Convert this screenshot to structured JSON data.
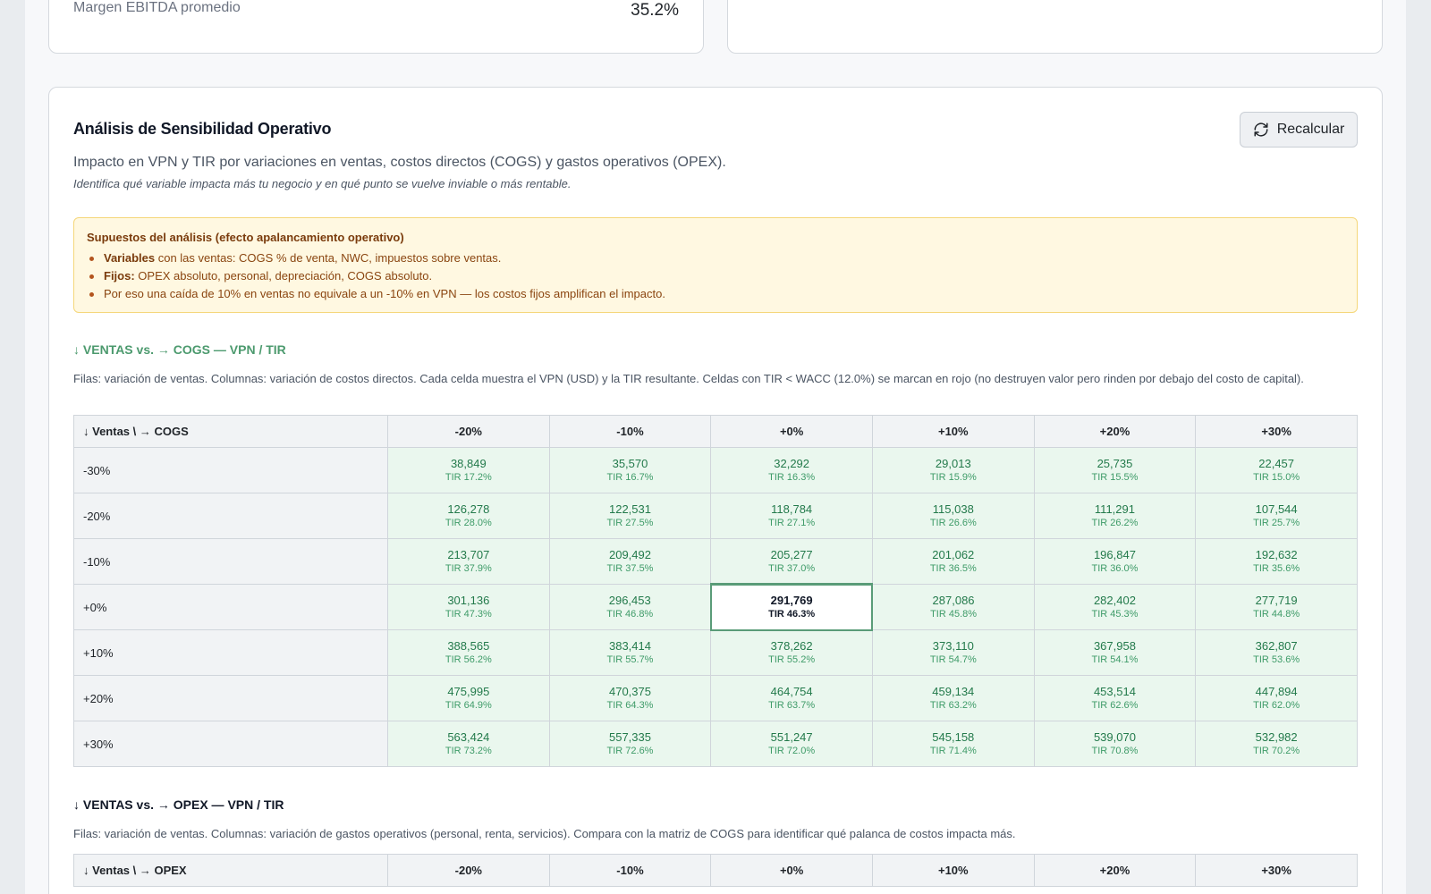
{
  "top_cards": {
    "left": {
      "label": "Margen EBITDA promedio",
      "value": "35.2%"
    }
  },
  "sensitivity": {
    "title": "Análisis de Sensibilidad Operativo",
    "recalc_label": "Recalcular",
    "subtitle": "Impacto en VPN y TIR por variaciones en ventas, costos directos (COGS) y gastos operativos (OPEX).",
    "subtitle_italic": "Identifica qué variable impacta más tu negocio y en qué punto se vuelve inviable o más rentable.",
    "assumptions": {
      "title": "Supuestos del análisis (efecto apalancamiento operativo)",
      "items": [
        {
          "strong": "Variables",
          "text": " con las ventas: COGS % de venta, NWC, impuestos sobre ventas."
        },
        {
          "strong": "Fijos:",
          "text": " OPEX absoluto, personal, depreciación, COGS absoluto."
        },
        {
          "strong": "",
          "text": "Por eso una caída de 10% en ventas no equivale a un -10% en VPN — los costos fijos amplifican el impacto."
        }
      ]
    },
    "matrix_cogs": {
      "title": "↓ VENTAS vs. → COGS — VPN / TIR",
      "description": "Filas: variación de ventas. Columnas: variación de costos directos. Cada celda muestra el VPN (USD) y la TIR resultante. Celdas con TIR < WACC (12.0%) se marcan en rojo (no destruyen valor pero rinden por debajo del costo de capital).",
      "corner": "↓ Ventas \\ → COGS",
      "columns": [
        "-20%",
        "-10%",
        "+0%",
        "+10%",
        "+20%",
        "+30%"
      ],
      "rows": [
        {
          "label": "-30%",
          "cells": [
            [
              "38,849",
              "TIR 17.2%"
            ],
            [
              "35,570",
              "TIR 16.7%"
            ],
            [
              "32,292",
              "TIR 16.3%"
            ],
            [
              "29,013",
              "TIR 15.9%"
            ],
            [
              "25,735",
              "TIR 15.5%"
            ],
            [
              "22,457",
              "TIR 15.0%"
            ]
          ]
        },
        {
          "label": "-20%",
          "cells": [
            [
              "126,278",
              "TIR 28.0%"
            ],
            [
              "122,531",
              "TIR 27.5%"
            ],
            [
              "118,784",
              "TIR 27.1%"
            ],
            [
              "115,038",
              "TIR 26.6%"
            ],
            [
              "111,291",
              "TIR 26.2%"
            ],
            [
              "107,544",
              "TIR 25.7%"
            ]
          ]
        },
        {
          "label": "-10%",
          "cells": [
            [
              "213,707",
              "TIR 37.9%"
            ],
            [
              "209,492",
              "TIR 37.5%"
            ],
            [
              "205,277",
              "TIR 37.0%"
            ],
            [
              "201,062",
              "TIR 36.5%"
            ],
            [
              "196,847",
              "TIR 36.0%"
            ],
            [
              "192,632",
              "TIR 35.6%"
            ]
          ]
        },
        {
          "label": "+0%",
          "cells": [
            [
              "301,136",
              "TIR 47.3%"
            ],
            [
              "296,453",
              "TIR 46.8%"
            ],
            [
              "291,769",
              "TIR 46.3%"
            ],
            [
              "287,086",
              "TIR 45.8%"
            ],
            [
              "282,402",
              "TIR 45.3%"
            ],
            [
              "277,719",
              "TIR 44.8%"
            ]
          ]
        },
        {
          "label": "+10%",
          "cells": [
            [
              "388,565",
              "TIR 56.2%"
            ],
            [
              "383,414",
              "TIR 55.7%"
            ],
            [
              "378,262",
              "TIR 55.2%"
            ],
            [
              "373,110",
              "TIR 54.7%"
            ],
            [
              "367,958",
              "TIR 54.1%"
            ],
            [
              "362,807",
              "TIR 53.6%"
            ]
          ]
        },
        {
          "label": "+20%",
          "cells": [
            [
              "475,995",
              "TIR 64.9%"
            ],
            [
              "470,375",
              "TIR 64.3%"
            ],
            [
              "464,754",
              "TIR 63.7%"
            ],
            [
              "459,134",
              "TIR 63.2%"
            ],
            [
              "453,514",
              "TIR 62.6%"
            ],
            [
              "447,894",
              "TIR 62.0%"
            ]
          ]
        },
        {
          "label": "+30%",
          "cells": [
            [
              "563,424",
              "TIR 73.2%"
            ],
            [
              "557,335",
              "TIR 72.6%"
            ],
            [
              "551,247",
              "TIR 72.0%"
            ],
            [
              "545,158",
              "TIR 71.4%"
            ],
            [
              "539,070",
              "TIR 70.8%"
            ],
            [
              "532,982",
              "TIR 70.2%"
            ]
          ]
        }
      ]
    },
    "matrix_opex": {
      "title": "↓ VENTAS vs. → OPEX — VPN / TIR",
      "description": "Filas: variación de ventas. Columnas: variación de gastos operativos (personal, renta, servicios). Compara con la matriz de COGS para identificar qué palanca de costos impacta más.",
      "corner": "↓ Ventas \\ → OPEX",
      "columns": [
        "-20%",
        "-10%",
        "+0%",
        "+10%",
        "+20%",
        "+30%"
      ]
    }
  }
}
